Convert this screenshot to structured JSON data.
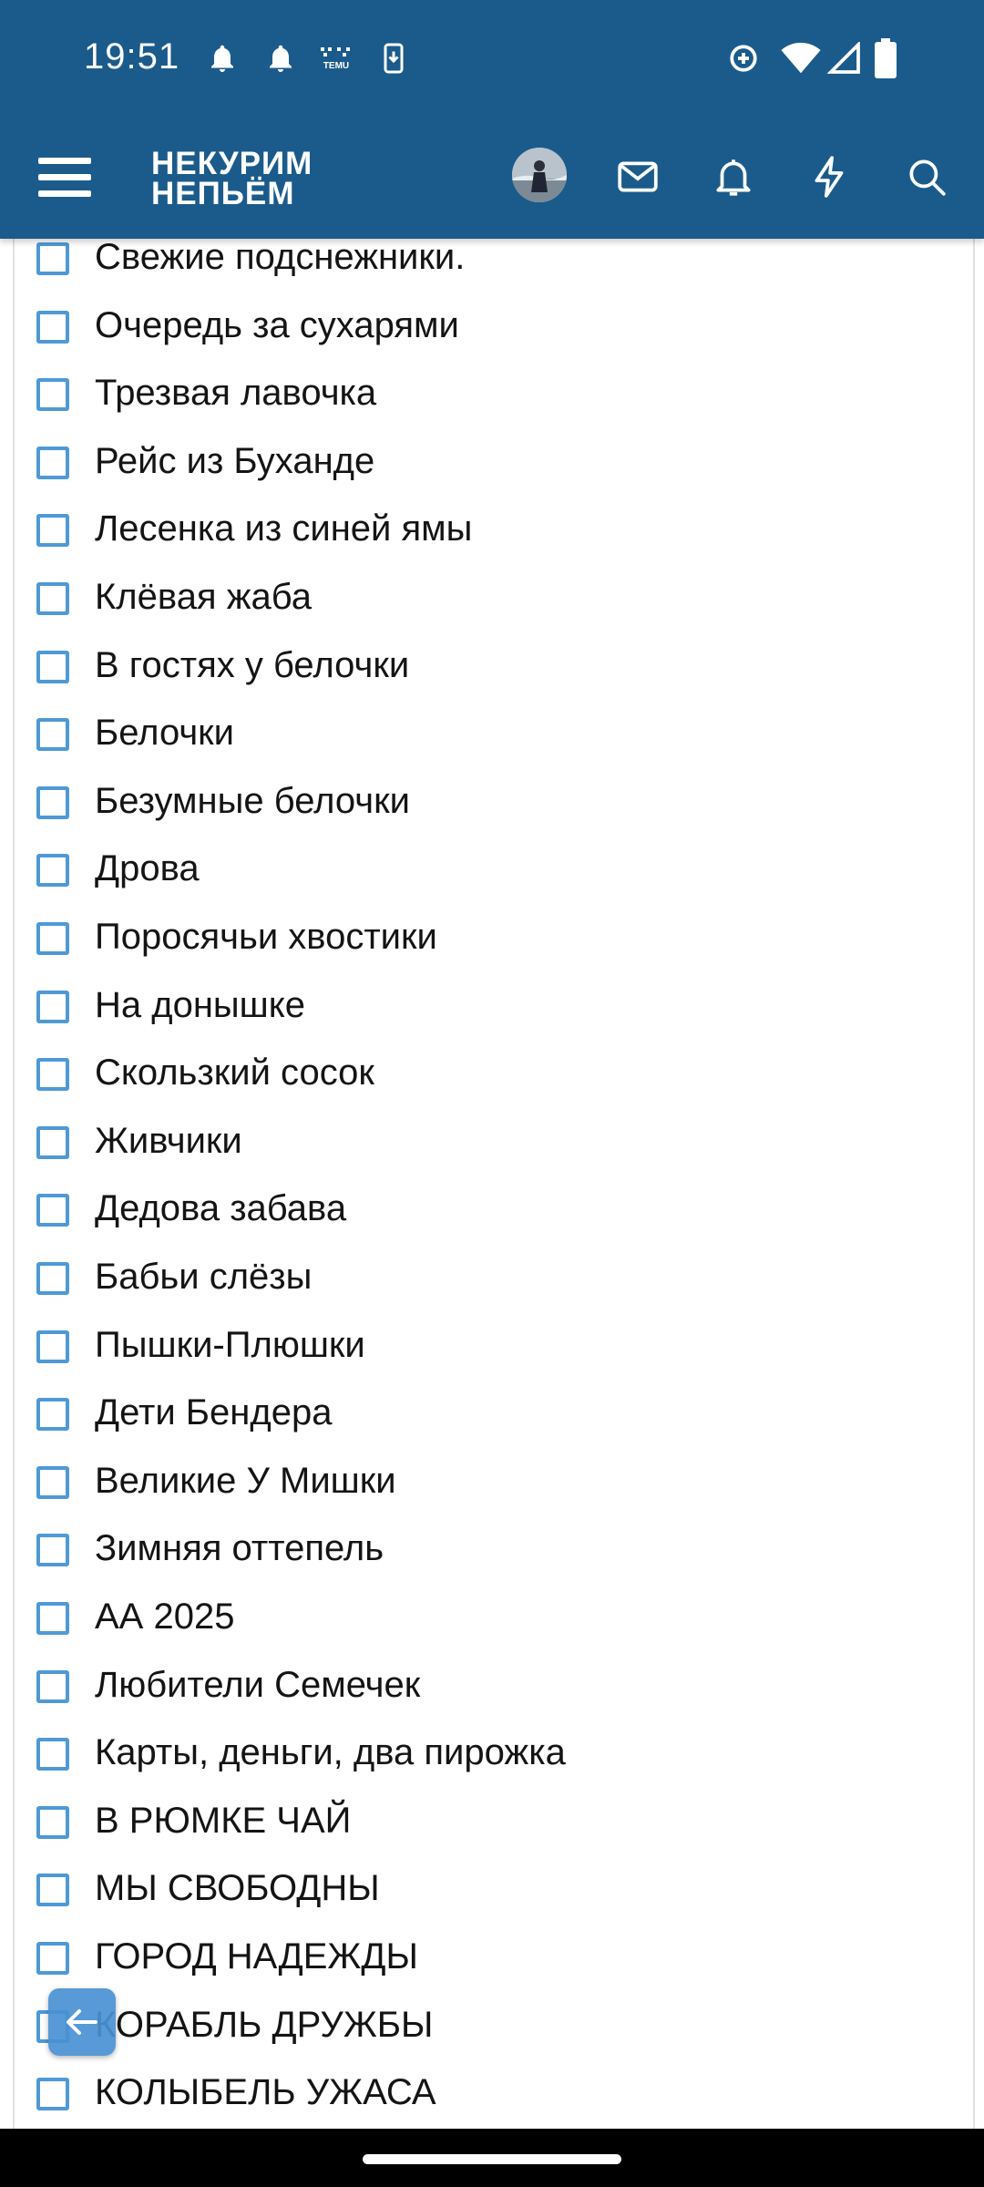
{
  "status_bar": {
    "time": "19:51",
    "temu_label": "TEMU",
    "icons": [
      "notification-bell-icon",
      "notification-bell-icon",
      "temu-app-icon",
      "download-icon",
      "data-saver-icon",
      "wifi-icon",
      "cell-signal-icon",
      "battery-icon"
    ]
  },
  "app_bar": {
    "logo_line1": "НЕКУРИМ",
    "logo_line2": "НЕПЬЁМ",
    "icons": [
      "menu-icon",
      "avatar",
      "mail-icon",
      "bell-icon",
      "lightning-icon",
      "search-icon"
    ]
  },
  "colors": {
    "header_bg": "#1b5b8b",
    "checkbox_border": "#4f99d6",
    "fab_bg": "#4a90d4",
    "text": "#141414"
  },
  "list": {
    "items": [
      {
        "label": "Свежие подснежники.",
        "checked": false
      },
      {
        "label": "Очередь за сухарями",
        "checked": false
      },
      {
        "label": "Трезвая лавочка",
        "checked": false
      },
      {
        "label": "Рейс из Буханде",
        "checked": false
      },
      {
        "label": "Лесенка из синей ямы",
        "checked": false
      },
      {
        "label": "Клёвая жаба",
        "checked": false
      },
      {
        "label": "В гостях у белочки",
        "checked": false
      },
      {
        "label": "Белочки",
        "checked": false
      },
      {
        "label": "Безумные белочки",
        "checked": false
      },
      {
        "label": "Дрова",
        "checked": false
      },
      {
        "label": "Поросячьи хвостики",
        "checked": false
      },
      {
        "label": "На донышке",
        "checked": false
      },
      {
        "label": "Скользкий сосок",
        "checked": false
      },
      {
        "label": "Живчики",
        "checked": false
      },
      {
        "label": "Дедова забава",
        "checked": false
      },
      {
        "label": "Бабьи слёзы",
        "checked": false
      },
      {
        "label": "Пышки-Плюшки",
        "checked": false
      },
      {
        "label": "Дети Бендера",
        "checked": false
      },
      {
        "label": "Великие У Мишки",
        "checked": false
      },
      {
        "label": "Зимняя оттепель",
        "checked": false
      },
      {
        "label": "АА 2025",
        "checked": false
      },
      {
        "label": "Любители Семечек",
        "checked": false
      },
      {
        "label": "Карты, деньги, два пирожка",
        "checked": false
      },
      {
        "label": "В РЮМКЕ ЧАЙ",
        "checked": false
      },
      {
        "label": "МЫ СВОБОДНЫ",
        "checked": false
      },
      {
        "label": "ГОРОД НАДЕЖДЫ",
        "checked": false
      },
      {
        "label": "КОРАБЛЬ ДРУЖБЫ",
        "checked": false
      },
      {
        "label": "КОЛЫБЕЛЬ УЖАСА",
        "checked": false
      }
    ]
  },
  "fab": {
    "icon": "arrow-left-icon"
  }
}
